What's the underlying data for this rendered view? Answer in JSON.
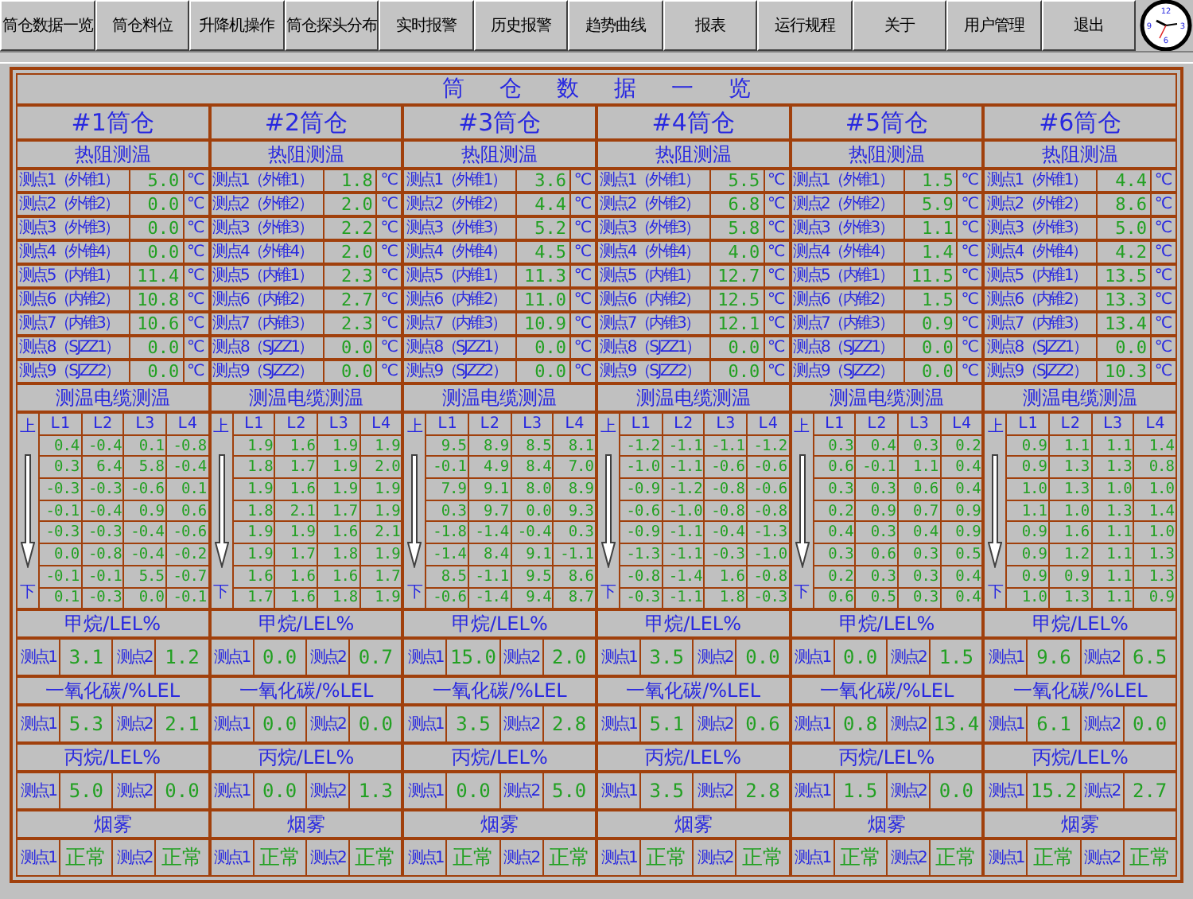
{
  "menu": [
    "筒仓数据一览",
    "筒仓料位",
    "升降机操作",
    "筒仓探头分布",
    "实时报警",
    "历史报警",
    "趋势曲线",
    "报表",
    "运行规程",
    "关于",
    "用户管理",
    "退出"
  ],
  "clock": {
    "numerals": [
      "12",
      "3",
      "6",
      "9"
    ]
  },
  "title": "筒仓数据一览",
  "bins": [
    {
      "name": "#1筒仓",
      "rtd_title": "热阻测温",
      "rtd": [
        {
          "label": "测点1（外锥1）",
          "value": "5.0",
          "unit": "℃"
        },
        {
          "label": "测点2（外锥2）",
          "value": "0.0",
          "unit": "℃"
        },
        {
          "label": "测点3（外锥3）",
          "value": "0.0",
          "unit": "℃"
        },
        {
          "label": "测点4（外锥4）",
          "value": "0.0",
          "unit": "℃"
        },
        {
          "label": "测点5（内锥1）",
          "value": "11.4",
          "unit": "℃"
        },
        {
          "label": "测点6（内锥2）",
          "value": "10.8",
          "unit": "℃"
        },
        {
          "label": "测点7（内锥3）",
          "value": "10.6",
          "unit": "℃"
        },
        {
          "label": "测点8（SJZZ1）",
          "value": "0.0",
          "unit": "℃"
        },
        {
          "label": "测点9（SJZZ2）",
          "value": "0.0",
          "unit": "℃"
        }
      ],
      "cable_title": "测温电缆测温",
      "cable_top": "上",
      "cable_bottom": "下",
      "cable_columns": [
        "L1",
        "L2",
        "L3",
        "L4"
      ],
      "cable_rows": [
        [
          "0.4",
          "-0.4",
          "0.1",
          "-0.8"
        ],
        [
          "0.3",
          "6.4",
          "5.8",
          "-0.4"
        ],
        [
          "-0.3",
          "-0.3",
          "-0.6",
          "0.1"
        ],
        [
          "-0.1",
          "-0.4",
          "0.9",
          "0.6"
        ],
        [
          "-0.3",
          "-0.3",
          "-0.4",
          "-0.6"
        ],
        [
          "0.0",
          "-0.8",
          "-0.4",
          "-0.2"
        ],
        [
          "-0.1",
          "-0.1",
          "5.5",
          "-0.7"
        ],
        [
          "0.1",
          "-0.3",
          "0.0",
          "-0.1"
        ]
      ],
      "gases": [
        {
          "kind": "number",
          "title": "甲烷/LEL%",
          "readings": [
            {
              "label": "测点1",
              "value": "3.1"
            },
            {
              "label": "测点2",
              "value": "1.2"
            }
          ]
        },
        {
          "kind": "number",
          "title": "一氧化碳/%LEL",
          "readings": [
            {
              "label": "测点1",
              "value": "5.3"
            },
            {
              "label": "测点2",
              "value": "2.1"
            }
          ]
        },
        {
          "kind": "number",
          "title": "丙烷/LEL%",
          "readings": [
            {
              "label": "测点1",
              "value": "5.0"
            },
            {
              "label": "测点2",
              "value": "0.0"
            }
          ]
        },
        {
          "kind": "status",
          "title": "烟雾",
          "readings": [
            {
              "label": "测点1",
              "value": "正常"
            },
            {
              "label": "测点2",
              "value": "正常"
            }
          ]
        }
      ]
    },
    {
      "name": "#2筒仓",
      "rtd_title": "热阻测温",
      "rtd": [
        {
          "label": "测点1（外锥1）",
          "value": "1.8",
          "unit": "℃"
        },
        {
          "label": "测点2（外锥2）",
          "value": "2.0",
          "unit": "℃"
        },
        {
          "label": "测点3（外锥3）",
          "value": "2.2",
          "unit": "℃"
        },
        {
          "label": "测点4（外锥4）",
          "value": "2.0",
          "unit": "℃"
        },
        {
          "label": "测点5（内锥1）",
          "value": "2.3",
          "unit": "℃"
        },
        {
          "label": "测点6（内锥2）",
          "value": "2.7",
          "unit": "℃"
        },
        {
          "label": "测点7（内锥3）",
          "value": "2.3",
          "unit": "℃"
        },
        {
          "label": "测点8（SJZZ1）",
          "value": "0.0",
          "unit": "℃"
        },
        {
          "label": "测点9（SJZZ2）",
          "value": "0.0",
          "unit": "℃"
        }
      ],
      "cable_title": "测温电缆测温",
      "cable_top": "上",
      "cable_bottom": "下",
      "cable_columns": [
        "L1",
        "L2",
        "L3",
        "L4"
      ],
      "cable_rows": [
        [
          "1.9",
          "1.6",
          "1.9",
          "1.9"
        ],
        [
          "1.8",
          "1.7",
          "1.9",
          "2.0"
        ],
        [
          "1.9",
          "1.6",
          "1.9",
          "1.9"
        ],
        [
          "1.8",
          "2.1",
          "1.7",
          "1.9"
        ],
        [
          "1.9",
          "1.9",
          "1.6",
          "2.1"
        ],
        [
          "1.9",
          "1.7",
          "1.8",
          "1.9"
        ],
        [
          "1.6",
          "1.6",
          "1.6",
          "1.7"
        ],
        [
          "1.7",
          "1.6",
          "1.8",
          "1.9"
        ]
      ],
      "gases": [
        {
          "kind": "number",
          "title": "甲烷/LEL%",
          "readings": [
            {
              "label": "测点1",
              "value": "0.0"
            },
            {
              "label": "测点2",
              "value": "0.7"
            }
          ]
        },
        {
          "kind": "number",
          "title": "一氧化碳/%LEL",
          "readings": [
            {
              "label": "测点1",
              "value": "0.0"
            },
            {
              "label": "测点2",
              "value": "0.0"
            }
          ]
        },
        {
          "kind": "number",
          "title": "丙烷/LEL%",
          "readings": [
            {
              "label": "测点1",
              "value": "0.0"
            },
            {
              "label": "测点2",
              "value": "1.3"
            }
          ]
        },
        {
          "kind": "status",
          "title": "烟雾",
          "readings": [
            {
              "label": "测点1",
              "value": "正常"
            },
            {
              "label": "测点2",
              "value": "正常"
            }
          ]
        }
      ]
    },
    {
      "name": "#3筒仓",
      "rtd_title": "热阻测温",
      "rtd": [
        {
          "label": "测点1（外锥1）",
          "value": "3.6",
          "unit": "℃"
        },
        {
          "label": "测点2（外锥2）",
          "value": "4.4",
          "unit": "℃"
        },
        {
          "label": "测点3（外锥3）",
          "value": "5.2",
          "unit": "℃"
        },
        {
          "label": "测点4（外锥4）",
          "value": "4.5",
          "unit": "℃"
        },
        {
          "label": "测点5（内锥1）",
          "value": "11.3",
          "unit": "℃"
        },
        {
          "label": "测点6（内锥2）",
          "value": "11.0",
          "unit": "℃"
        },
        {
          "label": "测点7（内锥3）",
          "value": "10.9",
          "unit": "℃"
        },
        {
          "label": "测点8（SJZZ1）",
          "value": "0.0",
          "unit": "℃"
        },
        {
          "label": "测点9（SJZZ2）",
          "value": "0.0",
          "unit": "℃"
        }
      ],
      "cable_title": "测温电缆测温",
      "cable_top": "上",
      "cable_bottom": "下",
      "cable_columns": [
        "L1",
        "L2",
        "L3",
        "L4"
      ],
      "cable_rows": [
        [
          "9.5",
          "8.9",
          "8.5",
          "8.1"
        ],
        [
          "-0.1",
          "4.9",
          "8.4",
          "7.0"
        ],
        [
          "7.9",
          "9.1",
          "8.0",
          "8.9"
        ],
        [
          "0.3",
          "9.7",
          "0.0",
          "9.3"
        ],
        [
          "-1.8",
          "-1.4",
          "-0.4",
          "0.3"
        ],
        [
          "-1.4",
          "8.4",
          "9.1",
          "-1.1"
        ],
        [
          "8.5",
          "-1.1",
          "9.5",
          "8.6"
        ],
        [
          "-0.6",
          "-1.4",
          "9.4",
          "8.7"
        ]
      ],
      "gases": [
        {
          "kind": "number",
          "title": "甲烷/LEL%",
          "readings": [
            {
              "label": "测点1",
              "value": "15.0"
            },
            {
              "label": "测点2",
              "value": "2.0"
            }
          ]
        },
        {
          "kind": "number",
          "title": "一氧化碳/%LEL",
          "readings": [
            {
              "label": "测点1",
              "value": "3.5"
            },
            {
              "label": "测点2",
              "value": "2.8"
            }
          ]
        },
        {
          "kind": "number",
          "title": "丙烷/LEL%",
          "readings": [
            {
              "label": "测点1",
              "value": "0.0"
            },
            {
              "label": "测点2",
              "value": "5.0"
            }
          ]
        },
        {
          "kind": "status",
          "title": "烟雾",
          "readings": [
            {
              "label": "测点1",
              "value": "正常"
            },
            {
              "label": "测点2",
              "value": "正常"
            }
          ]
        }
      ]
    },
    {
      "name": "#4筒仓",
      "rtd_title": "热阻测温",
      "rtd": [
        {
          "label": "测点1（外锥1）",
          "value": "5.5",
          "unit": "℃"
        },
        {
          "label": "测点2（外锥2）",
          "value": "6.8",
          "unit": "℃"
        },
        {
          "label": "测点3（外锥3）",
          "value": "5.8",
          "unit": "℃"
        },
        {
          "label": "测点4（外锥4）",
          "value": "4.0",
          "unit": "℃"
        },
        {
          "label": "测点5（内锥1）",
          "value": "12.7",
          "unit": "℃"
        },
        {
          "label": "测点6（内锥2）",
          "value": "12.5",
          "unit": "℃"
        },
        {
          "label": "测点7（内锥3）",
          "value": "12.1",
          "unit": "℃"
        },
        {
          "label": "测点8（SJZZ1）",
          "value": "0.0",
          "unit": "℃"
        },
        {
          "label": "测点9（SJZZ2）",
          "value": "0.0",
          "unit": "℃"
        }
      ],
      "cable_title": "测温电缆测温",
      "cable_top": "上",
      "cable_bottom": "下",
      "cable_columns": [
        "L1",
        "L2",
        "L3",
        "L4"
      ],
      "cable_rows": [
        [
          "-1.2",
          "-1.1",
          "-1.1",
          "-1.2"
        ],
        [
          "-1.0",
          "-1.1",
          "-0.6",
          "-0.6"
        ],
        [
          "-0.9",
          "-1.2",
          "-0.8",
          "-0.6"
        ],
        [
          "-0.6",
          "-1.0",
          "-0.8",
          "-0.8"
        ],
        [
          "-0.9",
          "-1.1",
          "-0.4",
          "-1.3"
        ],
        [
          "-1.3",
          "-1.1",
          "-0.3",
          "-1.0"
        ],
        [
          "-0.8",
          "-1.4",
          "1.6",
          "-0.8"
        ],
        [
          "-0.3",
          "-1.1",
          "1.8",
          "-0.3"
        ]
      ],
      "gases": [
        {
          "kind": "number",
          "title": "甲烷/LEL%",
          "readings": [
            {
              "label": "测点1",
              "value": "3.5"
            },
            {
              "label": "测点2",
              "value": "0.0"
            }
          ]
        },
        {
          "kind": "number",
          "title": "一氧化碳/%LEL",
          "readings": [
            {
              "label": "测点1",
              "value": "5.1"
            },
            {
              "label": "测点2",
              "value": "0.6"
            }
          ]
        },
        {
          "kind": "number",
          "title": "丙烷/LEL%",
          "readings": [
            {
              "label": "测点1",
              "value": "3.5"
            },
            {
              "label": "测点2",
              "value": "2.8"
            }
          ]
        },
        {
          "kind": "status",
          "title": "烟雾",
          "readings": [
            {
              "label": "测点1",
              "value": "正常"
            },
            {
              "label": "测点2",
              "value": "正常"
            }
          ]
        }
      ]
    },
    {
      "name": "#5筒仓",
      "rtd_title": "热阻测温",
      "rtd": [
        {
          "label": "测点1（外锥1）",
          "value": "1.5",
          "unit": "℃"
        },
        {
          "label": "测点2（外锥2）",
          "value": "5.9",
          "unit": "℃"
        },
        {
          "label": "测点3（外锥3）",
          "value": "1.1",
          "unit": "℃"
        },
        {
          "label": "测点4（外锥4）",
          "value": "1.4",
          "unit": "℃"
        },
        {
          "label": "测点5（内锥1）",
          "value": "11.5",
          "unit": "℃"
        },
        {
          "label": "测点6（内锥2）",
          "value": "1.5",
          "unit": "℃"
        },
        {
          "label": "测点7（内锥3）",
          "value": "0.9",
          "unit": "℃"
        },
        {
          "label": "测点8（SJZZ1）",
          "value": "0.0",
          "unit": "℃"
        },
        {
          "label": "测点9（SJZZ2）",
          "value": "0.0",
          "unit": "℃"
        }
      ],
      "cable_title": "测温电缆测温",
      "cable_top": "上",
      "cable_bottom": "下",
      "cable_columns": [
        "L1",
        "L2",
        "L3",
        "L4"
      ],
      "cable_rows": [
        [
          "0.3",
          "0.4",
          "0.3",
          "0.2"
        ],
        [
          "0.6",
          "-0.1",
          "1.1",
          "0.4"
        ],
        [
          "0.3",
          "0.3",
          "0.6",
          "0.4"
        ],
        [
          "0.2",
          "0.9",
          "0.7",
          "0.9"
        ],
        [
          "0.4",
          "0.3",
          "0.4",
          "0.9"
        ],
        [
          "0.3",
          "0.6",
          "0.3",
          "0.5"
        ],
        [
          "0.2",
          "0.3",
          "0.3",
          "0.4"
        ],
        [
          "0.6",
          "0.5",
          "0.3",
          "0.4"
        ]
      ],
      "gases": [
        {
          "kind": "number",
          "title": "甲烷/LEL%",
          "readings": [
            {
              "label": "测点1",
              "value": "0.0"
            },
            {
              "label": "测点2",
              "value": "1.5"
            }
          ]
        },
        {
          "kind": "number",
          "title": "一氧化碳/%LEL",
          "readings": [
            {
              "label": "测点1",
              "value": "0.8"
            },
            {
              "label": "测点2",
              "value": "13.4"
            }
          ]
        },
        {
          "kind": "number",
          "title": "丙烷/LEL%",
          "readings": [
            {
              "label": "测点1",
              "value": "1.5"
            },
            {
              "label": "测点2",
              "value": "0.0"
            }
          ]
        },
        {
          "kind": "status",
          "title": "烟雾",
          "readings": [
            {
              "label": "测点1",
              "value": "正常"
            },
            {
              "label": "测点2",
              "value": "正常"
            }
          ]
        }
      ]
    },
    {
      "name": "#6筒仓",
      "rtd_title": "热阻测温",
      "rtd": [
        {
          "label": "测点1（外锥1）",
          "value": "4.4",
          "unit": "℃"
        },
        {
          "label": "测点2（外锥2）",
          "value": "8.6",
          "unit": "℃"
        },
        {
          "label": "测点3（外锥3）",
          "value": "5.0",
          "unit": "℃"
        },
        {
          "label": "测点4（外锥4）",
          "value": "4.2",
          "unit": "℃"
        },
        {
          "label": "测点5（内锥1）",
          "value": "13.5",
          "unit": "℃"
        },
        {
          "label": "测点6（内锥2）",
          "value": "13.3",
          "unit": "℃"
        },
        {
          "label": "测点7（内锥3）",
          "value": "13.4",
          "unit": "℃"
        },
        {
          "label": "测点8（SJZZ1）",
          "value": "0.0",
          "unit": "℃"
        },
        {
          "label": "测点9（SJZZ2）",
          "value": "10.3",
          "unit": "℃"
        }
      ],
      "cable_title": "测温电缆测温",
      "cable_top": "上",
      "cable_bottom": "下",
      "cable_columns": [
        "L1",
        "L2",
        "L3",
        "L4"
      ],
      "cable_rows": [
        [
          "0.9",
          "1.1",
          "1.1",
          "1.4"
        ],
        [
          "0.9",
          "1.3",
          "1.3",
          "0.8"
        ],
        [
          "1.0",
          "1.3",
          "1.0",
          "1.0"
        ],
        [
          "1.1",
          "1.0",
          "1.3",
          "1.4"
        ],
        [
          "0.9",
          "1.6",
          "1.1",
          "1.0"
        ],
        [
          "0.9",
          "1.2",
          "1.1",
          "1.3"
        ],
        [
          "0.9",
          "0.9",
          "1.1",
          "1.3"
        ],
        [
          "1.0",
          "1.3",
          "1.1",
          "0.9"
        ]
      ],
      "gases": [
        {
          "kind": "number",
          "title": "甲烷/LEL%",
          "readings": [
            {
              "label": "测点1",
              "value": "9.6"
            },
            {
              "label": "测点2",
              "value": "6.5"
            }
          ]
        },
        {
          "kind": "number",
          "title": "一氧化碳/%LEL",
          "readings": [
            {
              "label": "测点1",
              "value": "6.1"
            },
            {
              "label": "测点2",
              "value": "0.0"
            }
          ]
        },
        {
          "kind": "number",
          "title": "丙烷/LEL%",
          "readings": [
            {
              "label": "测点1",
              "value": "15.2"
            },
            {
              "label": "测点2",
              "value": "2.7"
            }
          ]
        },
        {
          "kind": "status",
          "title": "烟雾",
          "readings": [
            {
              "label": "测点1",
              "value": "正常"
            },
            {
              "label": "测点2",
              "value": "正常"
            }
          ]
        }
      ]
    }
  ]
}
